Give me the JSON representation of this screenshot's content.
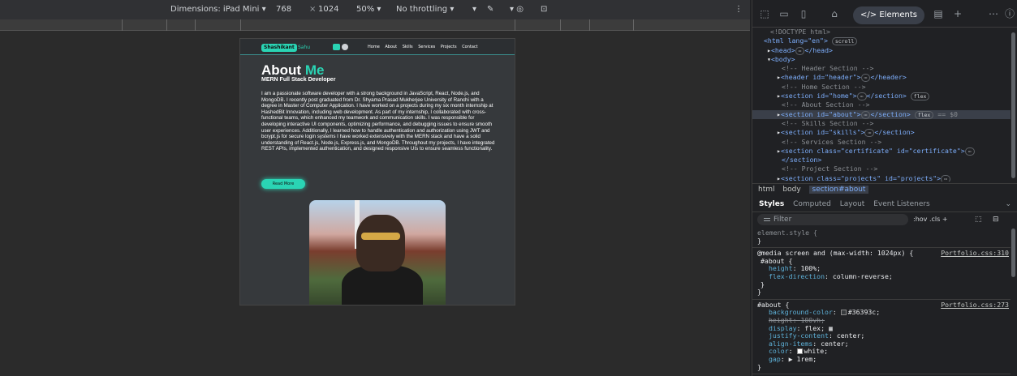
{
  "device_toolbar": {
    "dimensions_label": "Dimensions: iPad Mini",
    "width": "768",
    "times": "×",
    "height": "1024",
    "zoom": "50%",
    "throttling": "No throttling"
  },
  "site": {
    "logo_badge": "Shashikant",
    "logo_rest": "Sahu",
    "nav": [
      "Home",
      "About",
      "Skills",
      "Services",
      "Projects",
      "Contact"
    ],
    "about_title_part1": "About ",
    "about_title_accent": "Me",
    "about_subtitle": "MERN Full Stack Developer",
    "about_paragraph": "I am a passionate software developer with a strong background in JavaScript, React, Node.js, and MongoDB. I recently post graduated from Dr. Shyama Prasad Mukherjee University of Ranchi with a degree in Master of Computer Application. I have worked on a projects during my six month internship at HashedBit Innovation, including web development. As part of my internship, I collaborated with cross-functional teams, which enhanced my teamwork and communication skills. I was responsible for developing interactive UI components, optimizing performance, and debugging issues to ensure smooth user experiences. Additionally, I learned how to handle authentication and authorization using JWT and bcrypt.js for secure login systems I have worked extensively with the MERN stack and have a solid understanding of React.js, Node.js, Express.js, and MongoDB. Throughout my projects, I have integrated REST APIs, implemented authentication, and designed responsive UIs to ensure seamless functionality.",
    "read_more": "Read More",
    "accent_color": "#2ad4b4",
    "background_color": "#36393c"
  },
  "devtools": {
    "elements_tab": "Elements",
    "dom": {
      "doctype": "<!DOCTYPE html>",
      "html_open": "<html lang=\"en\">",
      "scroll_pill": "scroll",
      "head": "<head>",
      "head_close": "</head>",
      "body": "<body>",
      "c_header": "<!-- Header Section -->",
      "header_open": "<header id=\"header\">",
      "header_close": "</header>",
      "c_home": "<!-- Home Section -->",
      "home_open": "<section id=\"home\">",
      "section_close": "</section>",
      "flex_pill": "flex",
      "c_about": "<!-- About Section -->",
      "about_open": "<section id=\"about\">",
      "dollar_zero": "== $0",
      "c_skills": "<!-- Skills Section -->",
      "skills_open": "<section id=\"skills\">",
      "c_services": "<!-- Services Section -->",
      "cert_open": "<section class=\"certificate\" id=\"certificate\">",
      "c_project": "<!-- Project Section -->",
      "projects_open": "<section class=\"projects\" id=\"projects\">"
    },
    "breadcrumbs": [
      "html",
      "body",
      "section#about"
    ],
    "style_tabs": [
      "Styles",
      "Computed",
      "Layout",
      "Event Listeners"
    ],
    "filter_placeholder": "Filter",
    "filter_options": ":hov  .cls  +",
    "css": {
      "element_style": "element.style {",
      "close_brace": "}",
      "media_query": "@media screen and (max-width: 1024px) {",
      "media_src": "Portfolio.css:310",
      "media_selector": "#about {",
      "media_props": [
        {
          "name": "height",
          "value": "100%;"
        },
        {
          "name": "flex-direction",
          "value": "column-reverse;"
        }
      ],
      "about_selector": "#about {",
      "about_src": "Portfolio.css:273",
      "about_props": [
        {
          "name": "background-color",
          "value": "#36393c;"
        },
        {
          "name": "height",
          "value": "100vh;"
        },
        {
          "name": "display",
          "value": "flex;"
        },
        {
          "name": "justify-content",
          "value": "center;"
        },
        {
          "name": "align-items",
          "value": "center;"
        },
        {
          "name": "color",
          "value": "white;"
        },
        {
          "name": "gap",
          "value": "1rem;"
        }
      ]
    }
  }
}
